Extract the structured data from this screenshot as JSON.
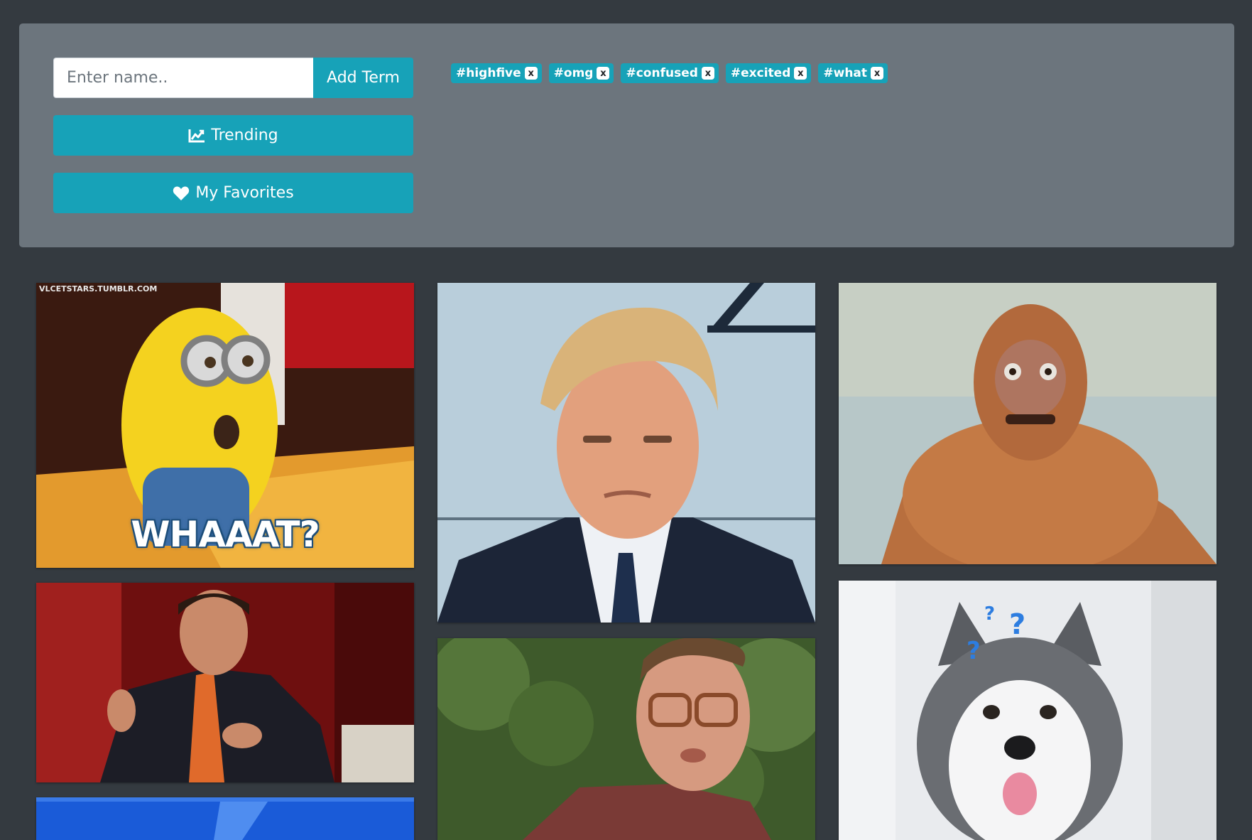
{
  "search": {
    "placeholder": "Enter name..",
    "value": "",
    "add_label": "Add Term"
  },
  "buttons": {
    "trending_label": "Trending",
    "trending_icon": "chart-line-icon",
    "favorites_label": "My Favorites",
    "favorites_icon": "heart-icon"
  },
  "tags": [
    {
      "label": "#highfive",
      "remove": "x"
    },
    {
      "label": "#omg",
      "remove": "x"
    },
    {
      "label": "#confused",
      "remove": "x"
    },
    {
      "label": "#excited",
      "remove": "x"
    },
    {
      "label": "#what",
      "remove": "x"
    }
  ],
  "gifs": [
    {
      "caption": "WHAAAT?",
      "watermark": "VLCETSTARS.TUMBLR.COM"
    }
  ],
  "colors": {
    "page_bg": "#343a40",
    "panel_bg": "#6c757d",
    "accent": "#17a2b8"
  }
}
